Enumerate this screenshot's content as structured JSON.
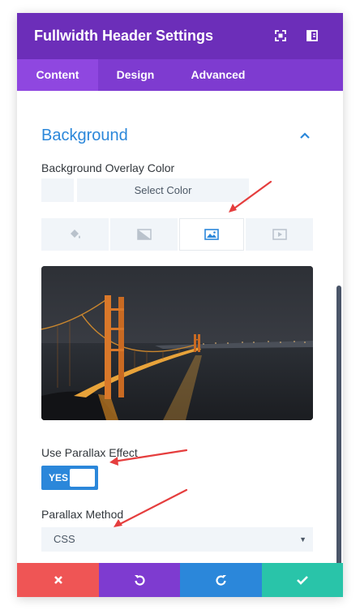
{
  "modal": {
    "title": "Fullwidth Header Settings",
    "header_icons": [
      "expand-icon",
      "sidebar-icon"
    ]
  },
  "tabs": [
    {
      "label": "Content",
      "active": true
    },
    {
      "label": "Design",
      "active": false
    },
    {
      "label": "Advanced",
      "active": false
    }
  ],
  "section": {
    "title": "Background",
    "collapse_icon": "chevron-up-icon"
  },
  "overlay": {
    "label": "Background Overlay Color",
    "select_color_label": "Select Color"
  },
  "background_tabs": [
    {
      "icon": "paint-bucket-icon",
      "active": false
    },
    {
      "icon": "gradient-icon",
      "active": false
    },
    {
      "icon": "image-icon",
      "active": true
    },
    {
      "icon": "video-icon",
      "active": false
    }
  ],
  "parallax": {
    "label": "Use Parallax Effect",
    "toggle_label": "YES",
    "enabled": true
  },
  "parallax_method": {
    "label": "Parallax Method",
    "value": "CSS"
  },
  "footer": [
    {
      "icon": "close-icon",
      "color": "#ef5555"
    },
    {
      "icon": "undo-icon",
      "color": "#7e3bd0"
    },
    {
      "icon": "redo-icon",
      "color": "#2b87da"
    },
    {
      "icon": "check-icon",
      "color": "#29c4a9"
    }
  ],
  "colors": {
    "header": "#6c2eb9",
    "tabs": "#7e3bd0",
    "accent": "#2b87da",
    "annotation": "#e53e3e"
  }
}
